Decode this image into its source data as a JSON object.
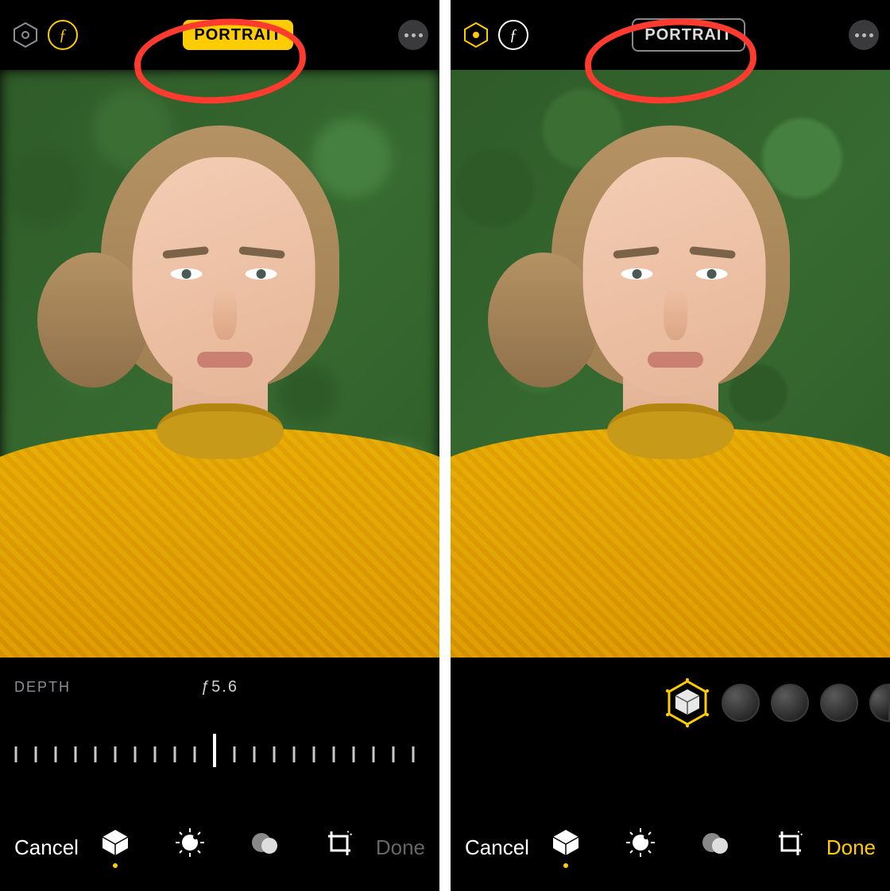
{
  "screens": {
    "left": {
      "top": {
        "portrait_label": "PORTRAIT",
        "portrait_active": true,
        "f_active": true,
        "hex_active": false
      },
      "depth": {
        "label": "DEPTH",
        "value": "ƒ5.6"
      },
      "footer": {
        "cancel": "Cancel",
        "done": "Done",
        "done_enabled": false,
        "active_tool": 0
      }
    },
    "right": {
      "top": {
        "portrait_label": "PORTRAIT",
        "portrait_active": false,
        "f_active": false,
        "hex_active": true
      },
      "footer": {
        "cancel": "Cancel",
        "done": "Done",
        "done_enabled": true,
        "active_tool": 0
      },
      "lighting_options_visible": 4
    }
  },
  "icons": {
    "hex": "portrait-lighting-hex-icon",
    "f": "aperture-f-icon",
    "more": "more-icon",
    "cube": "portrait-cube-icon",
    "adjust": "adjust-dial-icon",
    "filters": "filters-circles-icon",
    "crop": "crop-rotate-icon"
  },
  "colors": {
    "accent": "#ffcc00",
    "annotation": "#ff3b30"
  },
  "f_glyph": "ƒ"
}
